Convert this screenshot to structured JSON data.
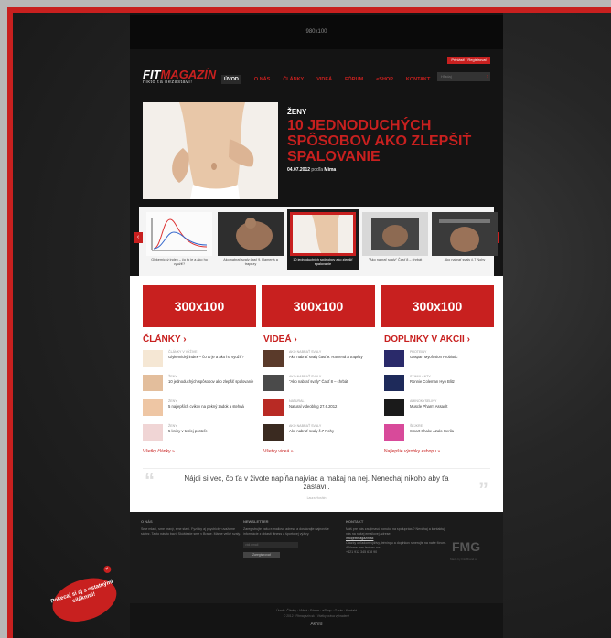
{
  "top_banner": {
    "label": "980x100"
  },
  "header": {
    "login_label": "Prihlásiť / Registrovať",
    "logo_name_part1": "FIT",
    "logo_name_part2": "MAGAZÍN",
    "logo_tagline": "nikto ťa nezastaví!",
    "search_placeholder": "Hľadaj",
    "nav": [
      "ÚVOD",
      "O NÁS",
      "ČLÁNKY",
      "VIDEÁ",
      "FÓRUM",
      "eSHOP",
      "KONTAKT"
    ]
  },
  "hero": {
    "category": "ŽENY",
    "title": "10 JEDNODUCHÝCH SPÔSOBOV AKO ZLEPŠIŤ SPALOVANIE",
    "date": "04.07.2012",
    "by_label": "podľa",
    "author": "Mima"
  },
  "carousel": {
    "slides": [
      {
        "caption": "Glykemický index – čo to je a ako ho využiť?"
      },
      {
        "caption": "Ako nabrať svaly časť 9. Ramená a trapézy"
      },
      {
        "caption": "10 jednoduchých spôsobov ako zlepšiť spalovanie"
      },
      {
        "caption": "\"Ako nabrať svaly\" Časť 8 – chrbát"
      },
      {
        "caption": "Ako nabrať svaly č.7 Nohy"
      }
    ]
  },
  "ads": [
    "300x100",
    "300x100",
    "300x100"
  ],
  "articles": {
    "title": "ČLÁNKY ›",
    "items": [
      {
        "kicker": "ČLÁNKY V VÝŽIVE",
        "text": "Glykemický index – čo to je a ako ho využiť?"
      },
      {
        "kicker": "ŽENY",
        "text": "10 jednoduchých spôsobov ako zlepšiť spalovanie"
      },
      {
        "kicker": "ŽENY",
        "text": "5 najlepších cvikov na pekný zadok a stehná"
      },
      {
        "kicker": "ŽENY",
        "text": "5 knihy v teplej posteľe"
      }
    ],
    "more": "Všetky články »"
  },
  "videos": {
    "title": "VIDEÁ ›",
    "items": [
      {
        "kicker": "AKO NABRAŤ SVALY",
        "text": "Ako nabrať svaly časť 9. Ramená a trapézy"
      },
      {
        "kicker": "AKO NABRAŤ SVALY",
        "text": "\"Ako nabrať svaly\" Časť 8 – chrbát"
      },
      {
        "kicker": "NATURAL",
        "text": "Natural videoblog 27.6.2012"
      },
      {
        "kicker": "AKO NABRAŤ SVALY",
        "text": "Ako nabrať svaly č.7 Nohy"
      }
    ],
    "more": "Všetky videá »"
  },
  "supplements": {
    "title": "DOPLNKY V AKCII ›",
    "items": [
      {
        "kicker": "PROTEINY",
        "text": "Gaspari Myofusion Probiotic"
      },
      {
        "kicker": "STIMULANTY",
        "text": "Ronnie Coleman Hyo Blitz"
      },
      {
        "kicker": "AMINOKYSELINY",
        "text": "Muscle Pharm Assault"
      },
      {
        "kicker": "ŠEJKRE",
        "text": "Smart Shake Azalo Gerila"
      }
    ],
    "more": "Najlepšie výrobky eshopu »"
  },
  "quote": {
    "text": "Nájdi si vec, čo ťa v živote napĺňa najviac a makaj na nej. Nenechaj nikoho aby ťa zastavil.",
    "author": "Laura Hoshin"
  },
  "footer": {
    "about_title": "O NÁS",
    "about_text": "Sme mladí, sme hravý, sme staví. Fyzicky aj psychicky uvažame sálbrz. Takto nás to baví. Skúšteste sme v Brane. Máme velké svaly.",
    "newsletter_title": "NEWSLETTER",
    "newsletter_text": "Zaregistrujte vašu e-mailovú adresu a dostávajte najnovšie informácie z oblasti fitness a športovej výživy.",
    "newsletter_placeholder": "váš email",
    "newsletter_button": "Zaregistrovať",
    "contact_title": "KONTAKT",
    "contact_text": "Máš pre nás zaujímavú ponuku na spoluprácu? Neváhaj a kontaktuj nás na našej emailovej adrese:",
    "contact_email": "info@fitmagazin.sk",
    "contact_text2": "Otázky ohľadom výživy, tréningu a doplnkov smerujte na naše fórum.",
    "contact_text3": "A Name tam lenivec na:",
    "contact_phone": "+421 912 345 678 90",
    "fmg_logo": "FMG",
    "fmg_sub": "Made by FitmBrand.cc"
  },
  "bottom": {
    "links": "Úvod · Články · Videá · Fórum · eShop · O nás · Kontakt",
    "copyright": "© 2012 · Fitmagazin.sk · Všetky práva vyhradené",
    "brand": "Akrea"
  },
  "badge": {
    "text": "Pokecaj si aj s ostatnými siláknmi!",
    "close": "×"
  }
}
